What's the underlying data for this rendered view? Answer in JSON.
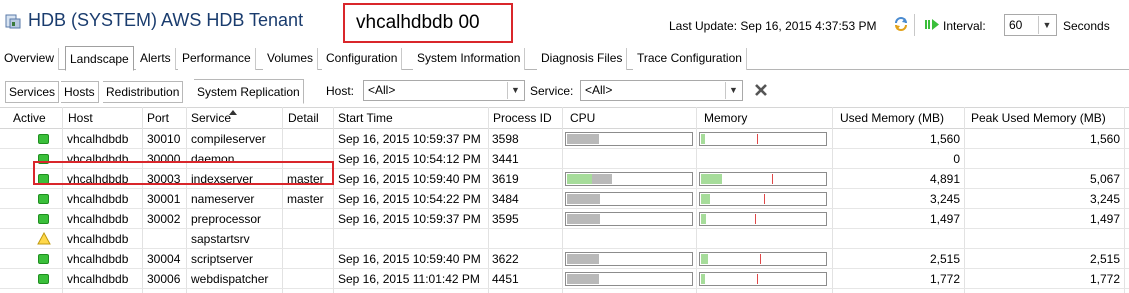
{
  "header": {
    "title": "HDB (SYSTEM) AWS HDB Tenant",
    "instance": "vhcalhdbdb 00",
    "last_update_label": "Last Update:",
    "last_update_value": "Sep 16, 2015 4:37:53 PM",
    "interval_label": "Interval:",
    "interval_value": "60",
    "seconds_label": "Seconds"
  },
  "main_tabs": [
    "Overview",
    "Landscape",
    "Alerts",
    "Performance",
    "Volumes",
    "Configuration",
    "System Information",
    "Diagnosis Files",
    "Trace Configuration"
  ],
  "sub_tabs": [
    "Services",
    "Hosts",
    "Redistribution",
    "System Replication"
  ],
  "filters": {
    "host_label": "Host:",
    "host_value": "<All>",
    "service_label": "Service:",
    "service_value": "<All>"
  },
  "columns": [
    "Active",
    "Host",
    "Port",
    "Service",
    "Detail",
    "Start Time",
    "Process ID",
    "CPU",
    "Memory",
    "Used Memory (MB)",
    "Peak Used Memory (MB)"
  ],
  "rows": [
    {
      "status": "green",
      "host": "vhcalhdbdb",
      "port": "30010",
      "service": "compileserver",
      "detail": "",
      "start": "Sep 16, 2015 10:59:37 PM",
      "pid": "3598",
      "cpu": {
        "used": 0.26,
        "green": 0
      },
      "mem": {
        "green": 0.03,
        "mark": 0.46
      },
      "used": "1,560",
      "peak": "1,560"
    },
    {
      "status": "green",
      "host": "vhcalhdbdb",
      "port": "30000",
      "service": "daemon",
      "detail": "",
      "start": "Sep 16, 2015 10:54:12 PM",
      "pid": "3441",
      "cpu": null,
      "mem": null,
      "used": "0",
      "peak": ""
    },
    {
      "status": "green",
      "host": "vhcalhdbdb",
      "port": "30003",
      "service": "indexserver",
      "detail": "master",
      "start": "Sep 16, 2015 10:59:40 PM",
      "pid": "3619",
      "cpu": {
        "used": 0.36,
        "green": 0.2
      },
      "mem": {
        "green": 0.17,
        "mark": 0.58
      },
      "used": "4,891",
      "peak": "5,067"
    },
    {
      "status": "green",
      "host": "vhcalhdbdb",
      "port": "30001",
      "service": "nameserver",
      "detail": "master",
      "start": "Sep 16, 2015 10:54:22 PM",
      "pid": "3484",
      "cpu": {
        "used": 0.27,
        "green": 0
      },
      "mem": {
        "green": 0.07,
        "mark": 0.52
      },
      "used": "3,245",
      "peak": "3,245"
    },
    {
      "status": "green",
      "host": "vhcalhdbdb",
      "port": "30002",
      "service": "preprocessor",
      "detail": "",
      "start": "Sep 16, 2015 10:59:37 PM",
      "pid": "3595",
      "cpu": {
        "used": 0.27,
        "green": 0
      },
      "mem": {
        "green": 0.04,
        "mark": 0.44
      },
      "used": "1,497",
      "peak": "1,497"
    },
    {
      "status": "warn",
      "host": "vhcalhdbdb",
      "port": "",
      "service": "sapstartsrv",
      "detail": "",
      "start": "",
      "pid": "",
      "cpu": null,
      "mem": null,
      "used": "",
      "peak": ""
    },
    {
      "status": "green",
      "host": "vhcalhdbdb",
      "port": "30004",
      "service": "scriptserver",
      "detail": "",
      "start": "Sep 16, 2015 10:59:40 PM",
      "pid": "3622",
      "cpu": {
        "used": 0.26,
        "green": 0
      },
      "mem": {
        "green": 0.06,
        "mark": 0.48
      },
      "used": "2,515",
      "peak": "2,515"
    },
    {
      "status": "green",
      "host": "vhcalhdbdb",
      "port": "30006",
      "service": "webdispatcher",
      "detail": "",
      "start": "Sep 16, 2015 11:01:42 PM",
      "pid": "4451",
      "cpu": {
        "used": 0.26,
        "green": 0
      },
      "mem": {
        "green": 0.03,
        "mark": 0.46
      },
      "used": "1,772",
      "peak": "1,772"
    }
  ],
  "icons": [
    "app-icon",
    "refresh-icon",
    "interval-play-icon",
    "dropdown-arrow-icon",
    "clear-filter-icon",
    "status-green-icon",
    "status-warning-icon",
    "sort-ascending-icon"
  ]
}
